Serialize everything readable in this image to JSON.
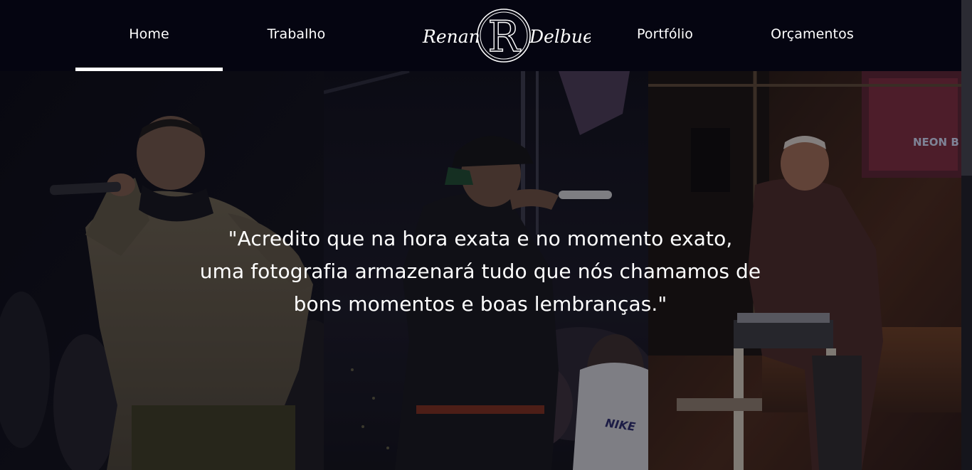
{
  "nav": {
    "items": [
      {
        "label": "Home",
        "active": true
      },
      {
        "label": "Trabalho",
        "active": false
      },
      {
        "label": "Portfólio",
        "active": false
      },
      {
        "label": "Orçamentos",
        "active": false
      }
    ],
    "logo": {
      "first": "Renan",
      "initial": "R",
      "last": "Delbue"
    }
  },
  "hero": {
    "quote_lines": [
      "\"Acredito que na hora exata e no momento exato,",
      "uma fotografia armazenará tudo que nós chamamos de",
      "bons momentos e boas lembranças.\""
    ],
    "photo_text": {
      "shirt": "NIKE",
      "sign": "NEON B"
    }
  },
  "colors": {
    "navbar_bg": "#050511",
    "text": "#ffffff",
    "active_indicator": "#ffffff"
  }
}
